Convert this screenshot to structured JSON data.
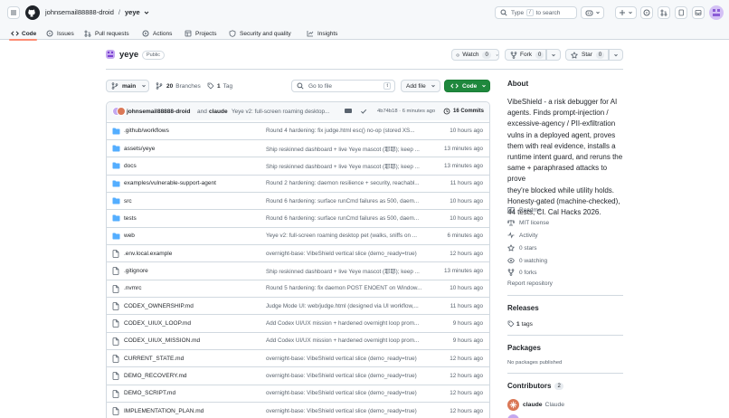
{
  "header": {
    "owner": "johnsemail88888-droid",
    "separator": "/",
    "repo": "yeye",
    "search_label": "Type",
    "search_key": "/",
    "search_suffix": "to search"
  },
  "nav": {
    "tabs": [
      {
        "label": "Code",
        "active": true
      },
      {
        "label": "Issues"
      },
      {
        "label": "Pull requests"
      },
      {
        "label": "Actions"
      },
      {
        "label": "Projects"
      },
      {
        "label": "Security and quality"
      },
      {
        "label": "Insights"
      }
    ]
  },
  "repo_header": {
    "name": "yeye",
    "visibility": "Public",
    "watch_label": "Watch",
    "watch_count": "0",
    "fork_label": "Fork",
    "fork_count": "0",
    "star_label": "Star",
    "star_count": "0"
  },
  "toolbar": {
    "branch": "main",
    "branches_count": "20",
    "branches_label": "Branches",
    "tags_count": "1",
    "tags_label": "Tag",
    "goto_placeholder": "Go to file",
    "goto_key": "t",
    "add_file_label": "Add file",
    "code_label": "Code"
  },
  "commit": {
    "author": "johnsemail88888-droid",
    "and_text": "and",
    "coauthor": "claude",
    "message": "Yeye v2: full-screen roaming desktop...",
    "hash_time": "4b74b18 · 6 minutes ago",
    "commits_label": "16 Commits"
  },
  "files": [
    {
      "type": "folder",
      "name": ".github/workflows",
      "message": "Round 4 hardening: fix judge.html esc() no-op (stored XS...",
      "time": "10 hours ago"
    },
    {
      "type": "folder",
      "name": "assets/yeye",
      "message": "Ship reskinned dashboard + live Yeye mascot (耶耶); keep ...",
      "time": "13 minutes ago"
    },
    {
      "type": "folder",
      "name": "docs",
      "message": "Ship reskinned dashboard + live Yeye mascot (耶耶); keep ...",
      "time": "13 minutes ago"
    },
    {
      "type": "folder",
      "name": "examples/vulnerable-support-agent",
      "message": "Round 2 hardening: daemon resilience + security, reachabl...",
      "time": "11 hours ago"
    },
    {
      "type": "folder",
      "name": "src",
      "message": "Round 6 hardening: surface runCmd failures as 500, daem...",
      "time": "10 hours ago"
    },
    {
      "type": "folder",
      "name": "tests",
      "message": "Round 6 hardening: surface runCmd failures as 500, daem...",
      "time": "10 hours ago"
    },
    {
      "type": "folder",
      "name": "web",
      "message": "Yeye v2: full-screen roaming desktop pet (walks, sniffs on ...",
      "time": "6 minutes ago"
    },
    {
      "type": "file",
      "name": ".env.local.example",
      "message": "overnight-base: VibeShield vertical slice (demo_ready=true)",
      "time": "12 hours ago"
    },
    {
      "type": "file",
      "name": ".gitignore",
      "message": "Ship reskinned dashboard + live Yeye mascot (耶耶); keep ...",
      "time": "13 minutes ago"
    },
    {
      "type": "file",
      "name": ".nvmrc",
      "message": "Round 5 hardening: fix daemon POST ENOENT on Window...",
      "time": "10 hours ago"
    },
    {
      "type": "file",
      "name": "CODEX_OWNERSHIP.md",
      "message": "Judge Mode UI: web/judge.html (designed via UI workflow,...",
      "time": "11 hours ago"
    },
    {
      "type": "file",
      "name": "CODEX_UIUX_LOOP.md",
      "message": "Add Codex UI/UX mission + hardened overnight loop prom...",
      "time": "9 hours ago"
    },
    {
      "type": "file",
      "name": "CODEX_UIUX_MISSION.md",
      "message": "Add Codex UI/UX mission + hardened overnight loop prom...",
      "time": "9 hours ago"
    },
    {
      "type": "file",
      "name": "CURRENT_STATE.md",
      "message": "overnight-base: VibeShield vertical slice (demo_ready=true)",
      "time": "12 hours ago"
    },
    {
      "type": "file",
      "name": "DEMO_RECOVERY.md",
      "message": "overnight-base: VibeShield vertical slice (demo_ready=true)",
      "time": "12 hours ago"
    },
    {
      "type": "file",
      "name": "DEMO_SCRIPT.md",
      "message": "overnight-base: VibeShield vertical slice (demo_ready=true)",
      "time": "12 hours ago"
    },
    {
      "type": "file",
      "name": "IMPLEMENTATION_PLAN.md",
      "message": "overnight-base: VibeShield vertical slice (demo_ready=true)",
      "time": "12 hours ago"
    }
  ],
  "about": {
    "heading": "About",
    "lines": [
      "VibeShield - a risk debugger for AI",
      "agents. Finds prompt-injection /",
      "excessive-agency / PII-exfiltration",
      "vulns in a deployed agent, proves",
      "them with real evidence, installs a",
      "runtime intent guard, and reruns the",
      "same + paraphrased attacks to prove",
      "they're blocked while utility holds.",
      "Honesty-gated (machine-checked),",
      "44 tests, CI. Cal Hacks 2026."
    ],
    "readme": "Readme",
    "license": "MIT license",
    "activity": "Activity",
    "stars": "0 stars",
    "watching": "0 watching",
    "forks": "0 forks",
    "report": "Report repository"
  },
  "releases": {
    "heading": "Releases",
    "tags_count": "1",
    "tags_label": "tags"
  },
  "packages": {
    "heading": "Packages",
    "empty": "No packages published"
  },
  "contributors": {
    "heading": "Contributors",
    "count": "2",
    "first_login": "claude",
    "first_name": "Claude"
  },
  "colors": {
    "accent": "#0969da",
    "code_button": "#1f883d",
    "folder": "#54aeff",
    "active_tab": "#fd8c73"
  }
}
